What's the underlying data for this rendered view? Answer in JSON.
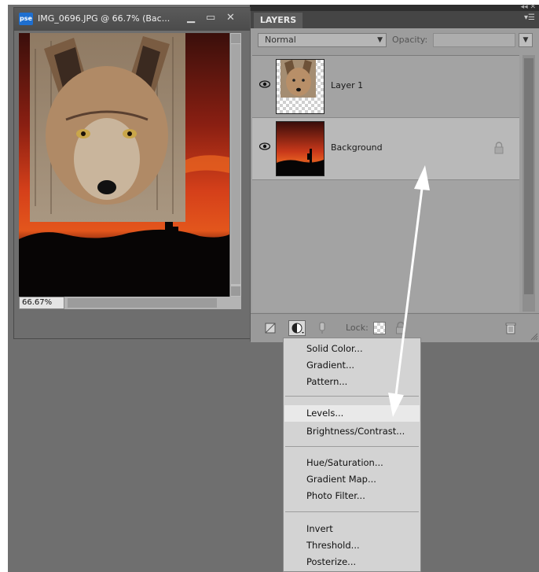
{
  "document": {
    "app_icon": "pse",
    "title": "IMG_0696.JPG @ 66.7% (Bac...",
    "zoom": "66.67%"
  },
  "layers_panel": {
    "tab_label": "LAYERS",
    "blend_mode": "Normal",
    "opacity_label": "Opacity:",
    "layers": [
      {
        "name": "Layer 1",
        "visible": true,
        "locked": false
      },
      {
        "name": "Background",
        "visible": true,
        "locked": true
      }
    ],
    "lock_label": "Lock:"
  },
  "adjustment_menu": {
    "groups": [
      [
        "Solid Color...",
        "Gradient...",
        "Pattern..."
      ],
      [
        "Levels...",
        "Brightness/Contrast..."
      ],
      [
        "Hue/Saturation...",
        "Gradient Map...",
        "Photo Filter..."
      ],
      [
        "Invert",
        "Threshold...",
        "Posterize..."
      ]
    ],
    "highlighted": "Levels..."
  },
  "colors": {
    "panel_bg": "#9d9d9d",
    "window_bg": "#6f6f6f",
    "menu_bg": "#d3d3d3",
    "annotation_arrow": "#ffffff"
  }
}
